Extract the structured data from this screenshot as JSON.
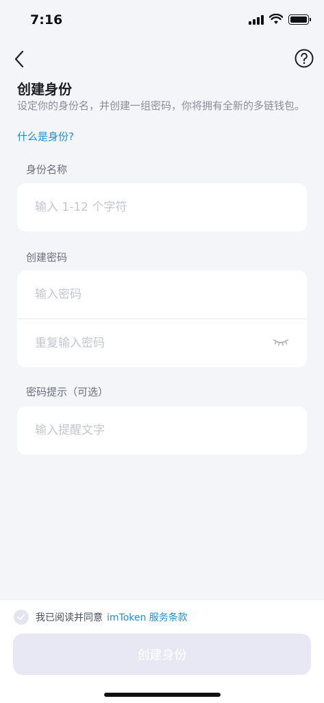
{
  "status_bar": {
    "time": "7:16"
  },
  "header": {
    "title": "创建身份",
    "description": "设定你的身份名，并创建一组密码，你将拥有全新的多链钱包。",
    "help_link": "什么是身份?"
  },
  "identity_section": {
    "label": "身份名称",
    "name_placeholder": "输入 1-12 个字符",
    "name_value": ""
  },
  "password_section": {
    "label": "创建密码",
    "password_placeholder": "输入密码",
    "password_value": "",
    "repeat_placeholder": "重复输入密码",
    "repeat_value": ""
  },
  "hint_section": {
    "label": "密码提示（可选）",
    "hint_placeholder": "输入提醒文字",
    "hint_value": ""
  },
  "footer": {
    "agree_text": "我已阅读并同意",
    "terms_link": "imToken 服务条款",
    "agreed": false,
    "create_button": "创建身份"
  },
  "colors": {
    "accent": "#1c8ecf",
    "background": "#f4f5f8",
    "button_disabled": "#e7e8f3",
    "placeholder": "#c3c6cf"
  },
  "icons": [
    "back-arrow-icon",
    "help-icon",
    "eye-closed-icon",
    "check-icon"
  ]
}
